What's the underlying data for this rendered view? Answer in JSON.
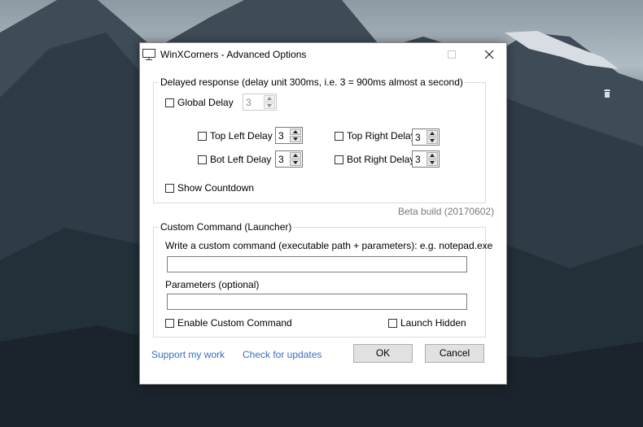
{
  "window": {
    "title": "WinXCorners - Advanced Options"
  },
  "delayed": {
    "legend": "Delayed response (delay unit 300ms, i.e. 3 = 900ms almost a second)",
    "global_delay_label": "Global Delay",
    "global_delay_value": "3",
    "top_left_label": "Top Left Delay",
    "top_left_value": "3",
    "top_right_label": "Top Right Delay",
    "top_right_value": "3",
    "bot_left_label": "Bot Left Delay",
    "bot_left_value": "3",
    "bot_right_label": "Bot Right Delay",
    "bot_right_value": "3",
    "show_countdown_label": "Show Countdown"
  },
  "beta_build": "Beta build (20170602)",
  "custom": {
    "legend": "Custom Command (Launcher)",
    "command_label": "Write a custom command (executable path + parameters): e.g. notepad.exe",
    "command_value": "",
    "parameters_label": "Parameters (optional)",
    "parameters_value": "",
    "enable_label": "Enable Custom Command",
    "launch_hidden_label": "Launch Hidden"
  },
  "footer": {
    "support_link": "Support my work",
    "updates_link": "Check for updates",
    "ok_label": "OK",
    "cancel_label": "Cancel"
  },
  "colors": {
    "link": "#3a6ebf",
    "beta_text": "#7a7a7a"
  }
}
